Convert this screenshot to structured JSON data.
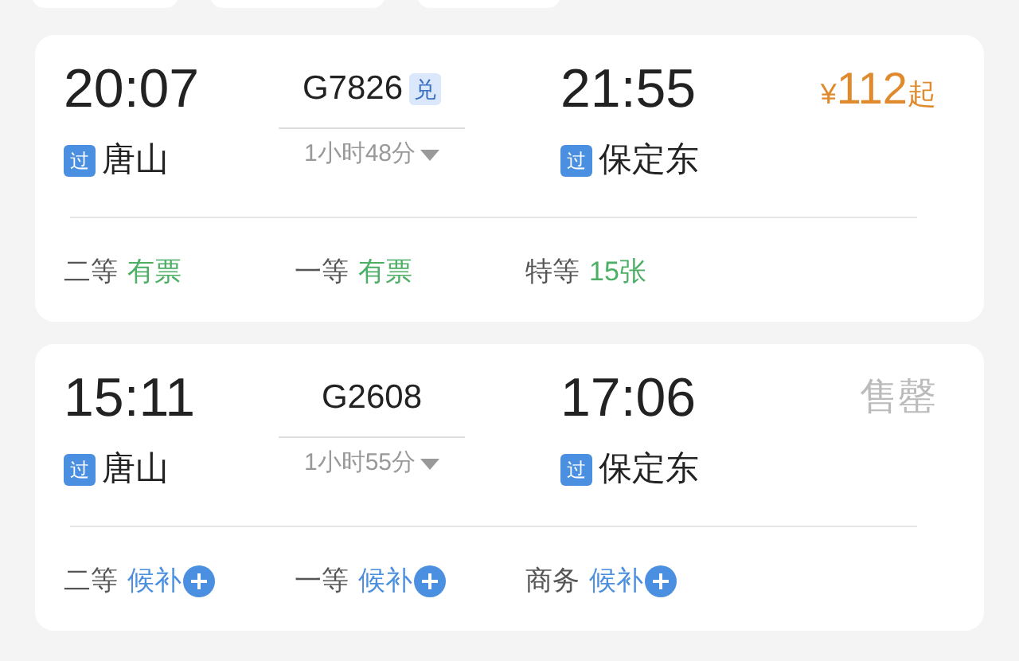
{
  "top_tabs": [
    {
      "kind": "tab"
    },
    {
      "kind": "tab"
    },
    {
      "kind": "tab"
    }
  ],
  "trains": [
    {
      "depart_time": "20:07",
      "depart_badge": "过",
      "depart_station": "唐山",
      "train_no": "G7826",
      "train_tag": "兑",
      "duration": "1小时48分",
      "arrive_time": "21:55",
      "arrive_badge": "过",
      "arrive_station": "保定东",
      "fare": {
        "kind": "price",
        "currency": "¥",
        "amount": "112",
        "suffix": "起"
      },
      "seats": [
        {
          "class": "二等",
          "availability": "有票",
          "kind": "available"
        },
        {
          "class": "一等",
          "availability": "有票",
          "kind": "available"
        },
        {
          "class": "特等",
          "availability": "15张",
          "kind": "available"
        }
      ]
    },
    {
      "depart_time": "15:11",
      "depart_badge": "过",
      "depart_station": "唐山",
      "train_no": "G2608",
      "duration": "1小时55分",
      "arrive_time": "17:06",
      "arrive_badge": "过",
      "arrive_station": "保定东",
      "fare": {
        "kind": "sold_out",
        "text": "售罄"
      },
      "seats": [
        {
          "class": "二等",
          "availability": "候补",
          "kind": "waitlist"
        },
        {
          "class": "一等",
          "availability": "候补",
          "kind": "waitlist"
        },
        {
          "class": "商务",
          "availability": "候补",
          "kind": "waitlist"
        }
      ]
    }
  ]
}
